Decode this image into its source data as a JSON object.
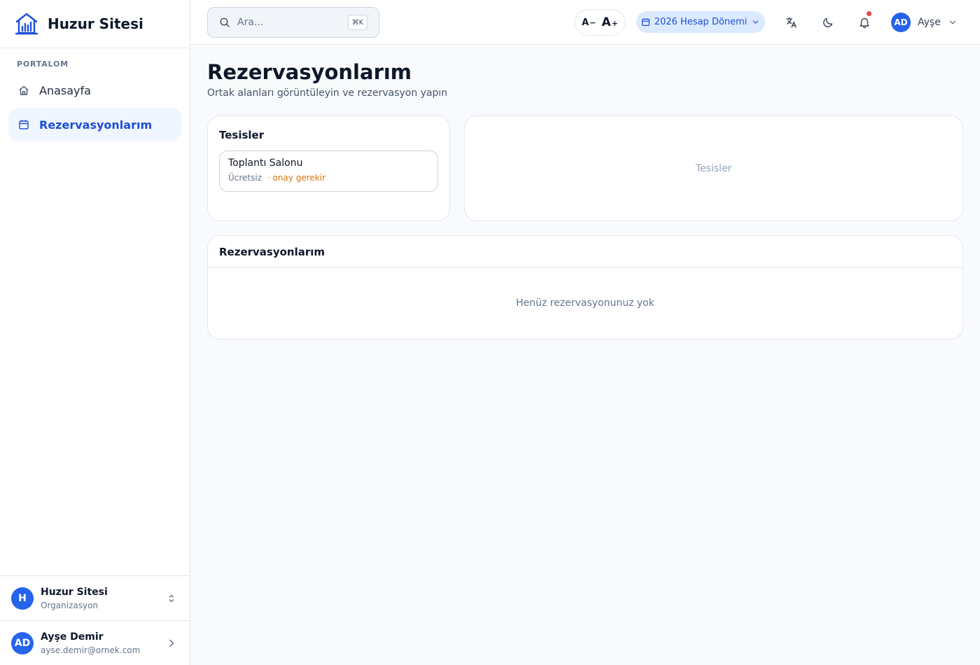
{
  "sidebar": {
    "brand": "Huzur Sitesi",
    "section_label": "PORTALOM",
    "items": [
      {
        "label": "Anasayfa",
        "icon": "home-icon",
        "active": false
      },
      {
        "label": "Rezervasyonlarım",
        "icon": "calendar-icon",
        "active": true
      }
    ],
    "org": {
      "initial": "H",
      "name": "Huzur Sitesi",
      "type": "Organizasyon"
    },
    "user": {
      "initials": "AD",
      "name": "Ayşe Demir",
      "email": "ayse.demir@ornek.com"
    }
  },
  "topbar": {
    "search_placeholder": "Ara...",
    "search_shortcut": "⌘K",
    "font_decrease": "A",
    "font_decrease_sign": "−",
    "font_increase": "A",
    "font_increase_sign": "+",
    "period_label": "2026 Hesap Dönemi",
    "user_initials": "AD",
    "user_name": "Ayşe"
  },
  "main": {
    "title": "Rezervasyonlarım",
    "subtitle": "Ortak alanları görüntüleyin ve rezervasyon yapın",
    "facilities_card": {
      "title": "Tesisler",
      "items": [
        {
          "name": "Toplantı Salonu",
          "price": "Ücretsiz",
          "approval": "· onay gerekir"
        }
      ]
    },
    "detail_placeholder": "Tesisler",
    "reservations_card": {
      "title": "Rezervasyonlarım",
      "empty_text": "Henüz rezervasyonunuz yok"
    }
  },
  "colors": {
    "accent": "#2563eb",
    "active_bg": "#eff6ff",
    "warning": "#d97706",
    "notification": "#ef4444"
  }
}
